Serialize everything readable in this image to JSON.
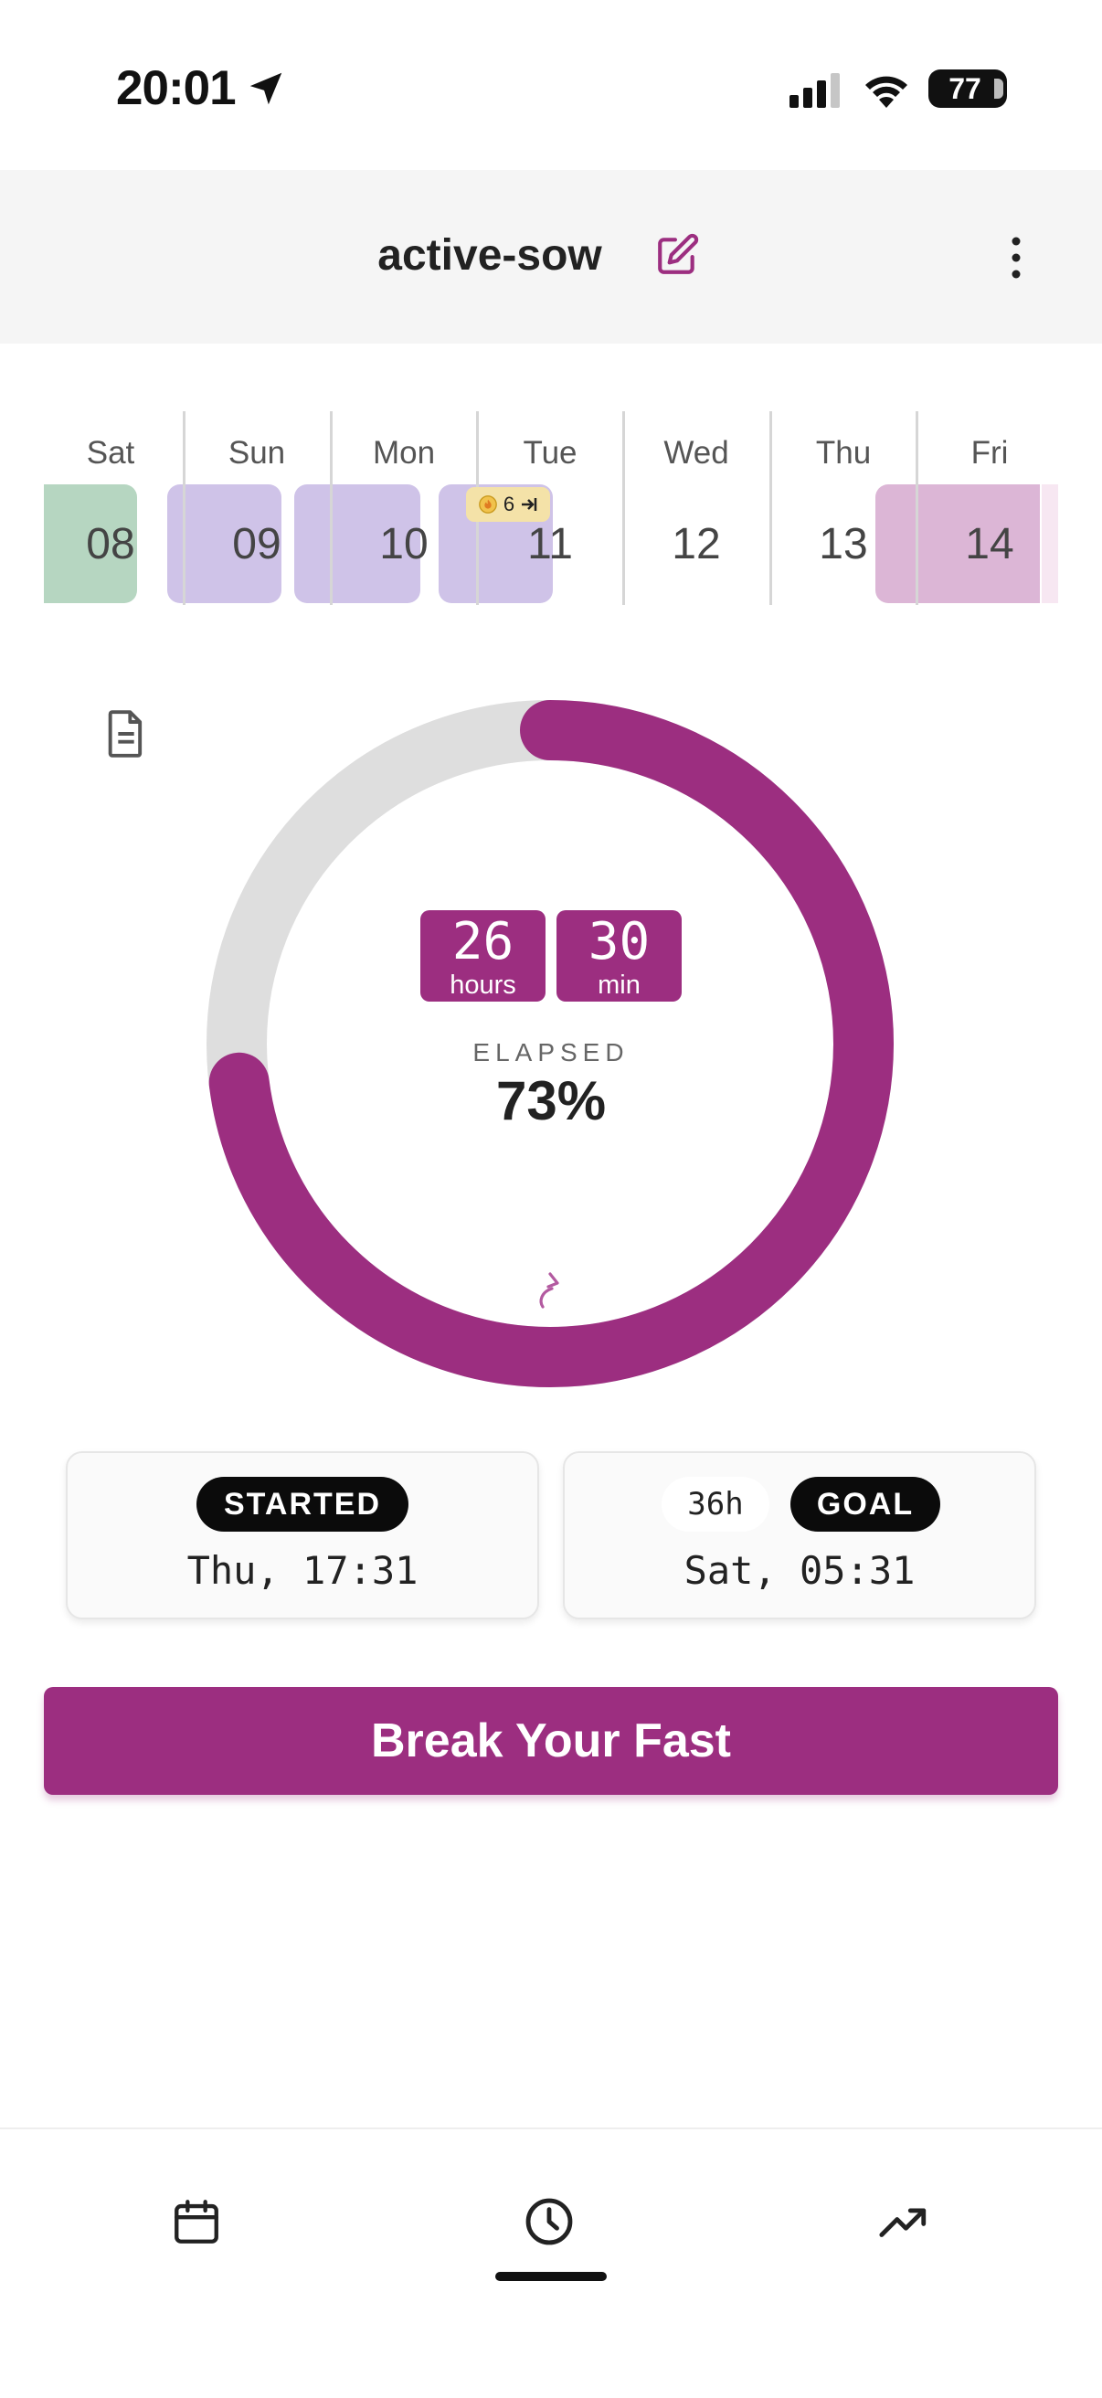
{
  "status_bar": {
    "time": "20:01",
    "battery": "77"
  },
  "header": {
    "title": "active-sow"
  },
  "week": {
    "days": [
      {
        "name": "Sat",
        "num": "08"
      },
      {
        "name": "Sun",
        "num": "09"
      },
      {
        "name": "Mon",
        "num": "10"
      },
      {
        "name": "Tue",
        "num": "11"
      },
      {
        "name": "Wed",
        "num": "12"
      },
      {
        "name": "Thu",
        "num": "13"
      },
      {
        "name": "Fri",
        "num": "14"
      }
    ],
    "badge": "6"
  },
  "timer": {
    "hours": "26",
    "hours_label": "hours",
    "minutes": "30",
    "minutes_label": "min",
    "elapsed_label": "ELAPSED",
    "elapsed_percent": "73%",
    "progress": 0.73
  },
  "started": {
    "label": "STARTED",
    "value": "Thu, 17:31"
  },
  "goal": {
    "duration": "36h",
    "label": "GOAL",
    "value": "Sat, 05:31"
  },
  "action": {
    "break_label": "Break Your Fast"
  },
  "colors": {
    "accent": "#9c2e80",
    "fasting_light": "#cfc3e8",
    "green_day": "#b6d6c1",
    "pink_day": "#dcb6d6",
    "ring_track": "#dedede"
  },
  "nav": {
    "items": [
      "calendar-icon",
      "clock-icon",
      "trending-icon"
    ],
    "active": "clock-icon"
  }
}
